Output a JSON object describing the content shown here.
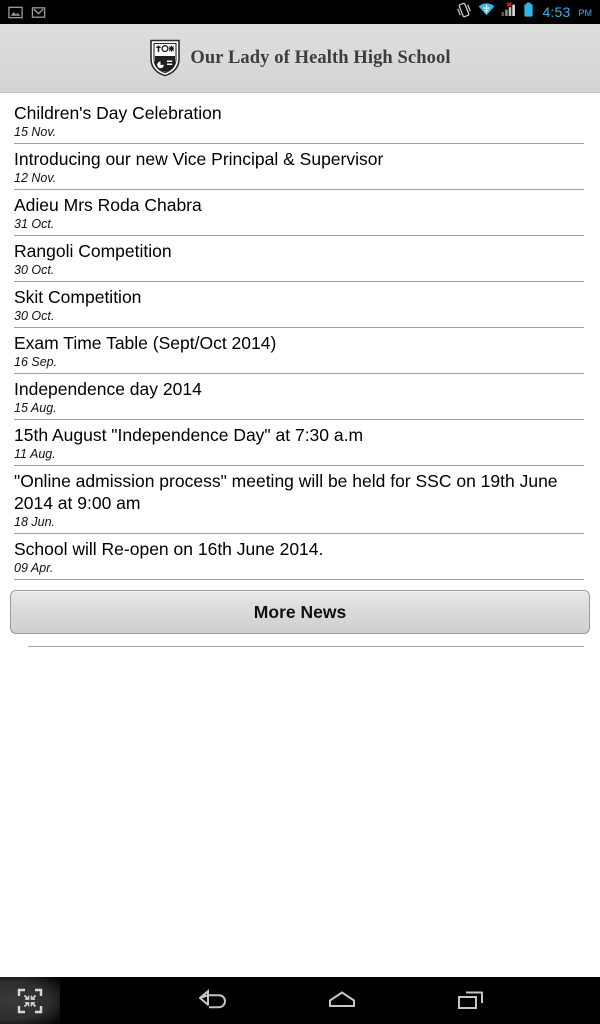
{
  "status_bar": {
    "notifications": [
      {
        "icon": "image-notification-icon"
      },
      {
        "icon": "gmail-notification-icon"
      }
    ],
    "indicators": [
      {
        "icon": "vibrate-icon"
      },
      {
        "icon": "wifi-icon"
      },
      {
        "icon": "cellular-signal-no-service-icon"
      },
      {
        "icon": "battery-icon"
      }
    ],
    "time": "4:53",
    "period": "PM",
    "accent_color": "#33b5e5",
    "background_color": "#000000"
  },
  "header": {
    "logo_icon": "school-crest-icon",
    "title": "Our Lady of Health High School",
    "background_color": "#d9d9d8",
    "text_color": "#3d3d3d"
  },
  "news": {
    "items": [
      {
        "title": "Children's Day Celebration",
        "date": "15 Nov."
      },
      {
        "title": "Introducing our new Vice Principal & Supervisor",
        "date": "12 Nov."
      },
      {
        "title": "Adieu Mrs Roda Chabra",
        "date": "31 Oct."
      },
      {
        "title": "Rangoli Competition",
        "date": "30 Oct."
      },
      {
        "title": "Skit Competition",
        "date": "30 Oct."
      },
      {
        "title": "Exam Time Table (Sept/Oct 2014)",
        "date": "16 Sep."
      },
      {
        "title": "Independence day 2014",
        "date": "15 Aug."
      },
      {
        "title": "15th August \"Independence Day\" at 7:30 a.m",
        "date": "11 Aug."
      },
      {
        "title": "\"Online admission process\" meeting will be held for SSC on 19th June 2014 at 9:00 am",
        "date": "18 Jun."
      },
      {
        "title": "School will Re-open on 16th June 2014.",
        "date": "09 Apr."
      }
    ]
  },
  "more_news_button": {
    "label": "More News"
  },
  "nav_bar": {
    "shrink_icon": "shrink-to-fit-icon",
    "back_icon": "back-arrow-icon",
    "home_icon": "home-icon",
    "recents_icon": "recent-apps-icon",
    "background_color": "#000000"
  }
}
